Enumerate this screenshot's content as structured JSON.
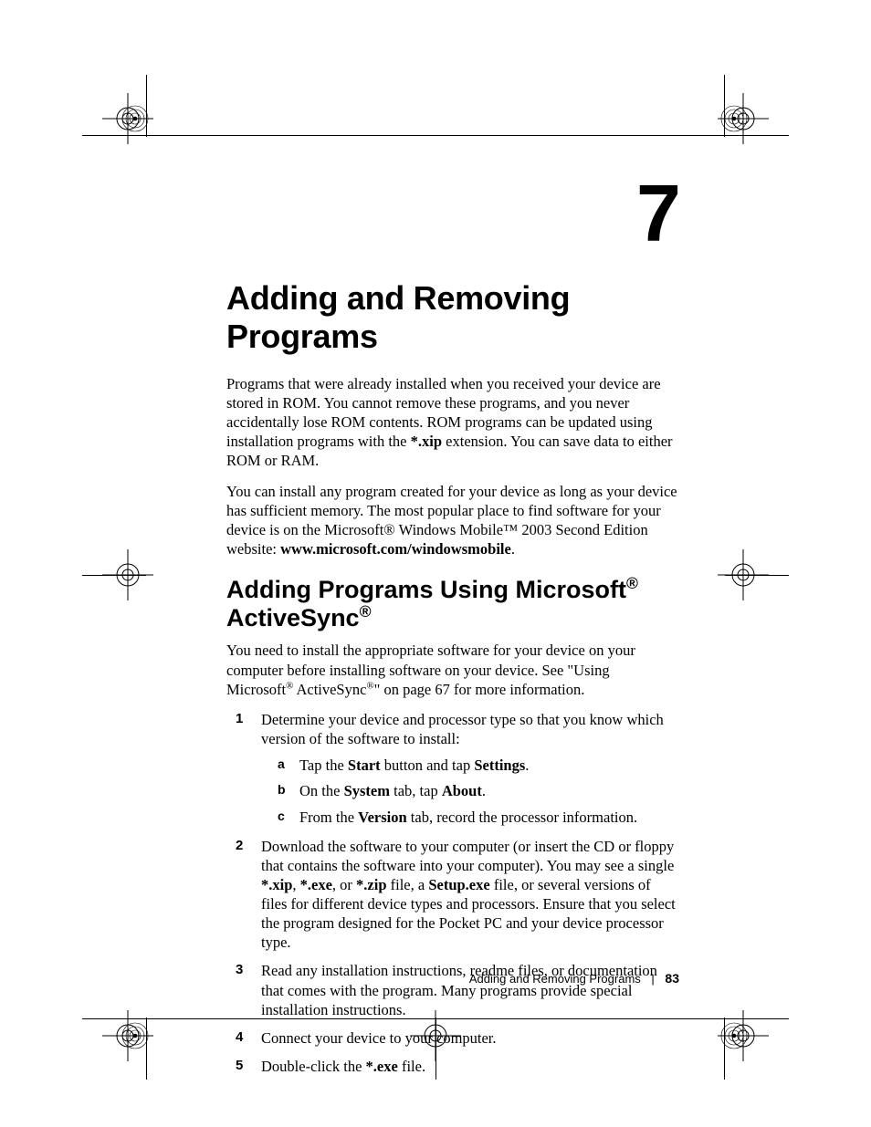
{
  "chapter_number": "7",
  "chapter_title": "Adding and Removing Programs",
  "intro_paragraphs": [
    "Programs that were already installed when you received your device are stored in ROM. You cannot remove these programs, and you never accidentally lose ROM contents. ROM programs can be updated using installation programs with the *.xip extension. You can save data to either ROM or RAM.",
    "You can install any program created for your device as long as your device has sufficient memory. The most popular place to find software for your device is on the Microsoft® Windows Mobile™ 2003 Second Edition website: www.microsoft.com/windowsmobile."
  ],
  "intro_bold_tokens": [
    "*.xip",
    "www.microsoft.com/windowsmobile"
  ],
  "section_title": "Adding Programs Using Microsoft® ActiveSync®",
  "section_intro": "You need to install the appropriate software for your device on your computer before installing software on your device. See \"Using Microsoft® ActiveSync®\" on page 67 for more information.",
  "steps": [
    {
      "text": "Determine your device and processor type so that you know which version of the software to install:",
      "substeps": [
        "Tap the Start button and tap Settings.",
        "On the System tab, tap About.",
        "From the Version tab, record the processor information."
      ]
    },
    {
      "text": "Download the software to your computer (or insert the CD or floppy that contains the software into your computer). You may see a single *.xip, *.exe, or *.zip file, a Setup.exe file, or several versions of files for different device types and processors. Ensure that you select the program designed for the Pocket PC and your device processor type."
    },
    {
      "text": "Read any installation instructions, readme files, or documentation that comes with the program. Many programs provide special installation instructions."
    },
    {
      "text": "Connect your device to your computer."
    },
    {
      "text": "Double-click the *.exe file."
    }
  ],
  "step_bold_tokens": [
    "Start",
    "Settings",
    "System",
    "About",
    "Version",
    "*.xip",
    "*.exe",
    "*.zip",
    "Setup.exe"
  ],
  "footer": {
    "section": "Adding and Removing Programs",
    "page": "83"
  }
}
